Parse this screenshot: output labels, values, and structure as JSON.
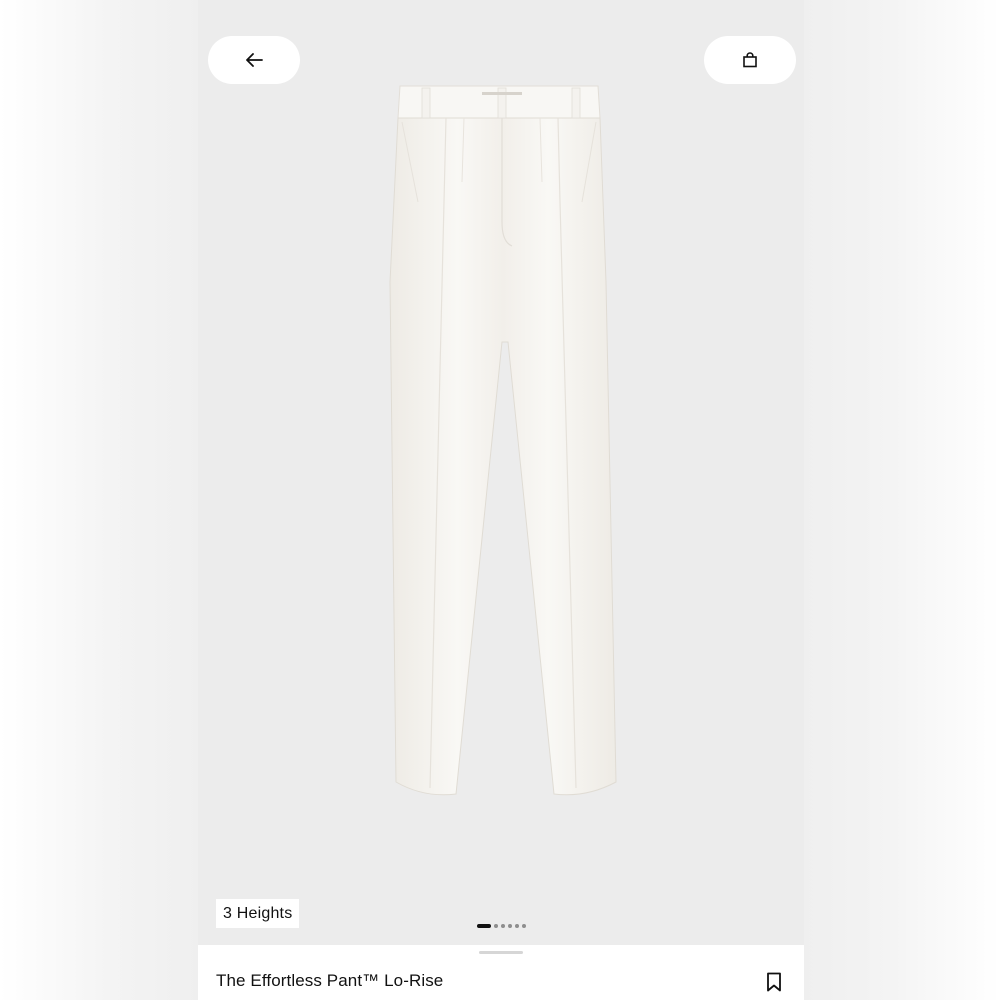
{
  "header": {
    "back_icon": "arrow-left-icon",
    "bag_icon": "shopping-bag-icon"
  },
  "product": {
    "badge": "3 Heights",
    "title": "The Effortless Pant™ Lo-Rise",
    "bookmark_icon": "bookmark-icon",
    "image_subject": "cream pleated trouser"
  },
  "carousel": {
    "total": 6,
    "active_index": 0
  },
  "colors": {
    "background": "#ececec",
    "button": "#ffffff",
    "text": "#111111",
    "garment": "#f7f5f1"
  }
}
